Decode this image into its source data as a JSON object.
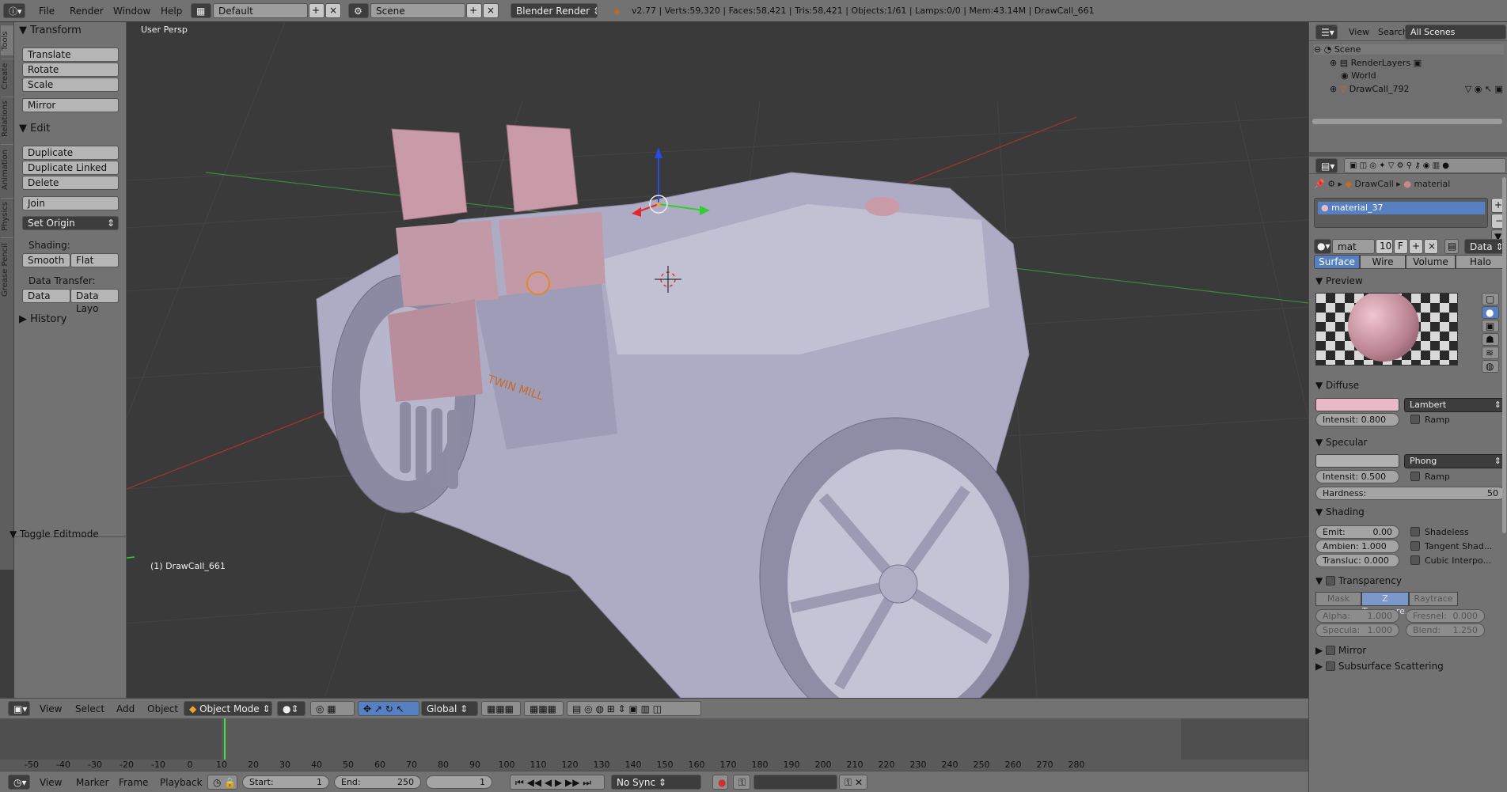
{
  "topbar": {
    "menus": [
      "File",
      "Render",
      "Window",
      "Help"
    ],
    "layout": "Default",
    "scene": "Scene",
    "engine": "Blender Render",
    "stats": "v2.77 | Verts:59,320 | Faces:58,421 | Tris:58,421 | Objects:1/61 | Lamps:0/0 | Mem:43.14M | DrawCall_661"
  },
  "left_tabs": [
    "Tools",
    "Create",
    "Relations",
    "Animation",
    "Physics",
    "Grease Pencil"
  ],
  "toolshelf": {
    "transform_header": "Transform",
    "translate": "Translate",
    "rotate": "Rotate",
    "scale": "Scale",
    "mirror": "Mirror",
    "edit_header": "Edit",
    "duplicate": "Duplicate",
    "duplicate_linked": "Duplicate Linked",
    "delete": "Delete",
    "join": "Join",
    "set_origin": "Set Origin",
    "shading_label": "Shading:",
    "smooth": "Smooth",
    "flat": "Flat",
    "data_transfer_label": "Data Transfer:",
    "data": "Data",
    "data_layout": "Data Layo",
    "history_header": "History",
    "toggle_editmode": "Toggle Editmode"
  },
  "viewport": {
    "view_label": "User Persp",
    "object_label": "(1) DrawCall_661",
    "decal_text": "TWIN MILL",
    "colors": {
      "body": "#aeacc4",
      "pink": "#c99aa8",
      "bg": "#3a3a3a"
    }
  },
  "view_header": {
    "menus": [
      "View",
      "Select",
      "Add",
      "Object"
    ],
    "mode": "Object Mode",
    "orientation": "Global"
  },
  "timeline": {
    "ticks": [
      "-50",
      "-40",
      "-30",
      "-20",
      "-10",
      "0",
      "10",
      "20",
      "30",
      "40",
      "50",
      "60",
      "70",
      "80",
      "90",
      "100",
      "110",
      "120",
      "130",
      "140",
      "150",
      "160",
      "170",
      "180",
      "190",
      "200",
      "210",
      "220",
      "230",
      "240",
      "250",
      "260",
      "270",
      "280"
    ],
    "current_frame_value": 0
  },
  "timeline_header": {
    "menus": [
      "View",
      "Marker",
      "Frame",
      "Playback"
    ],
    "start": "Start:",
    "start_val": "1",
    "end": "End:",
    "end_val": "250",
    "frame_val": "1",
    "sync": "No Sync"
  },
  "outliner": {
    "menus": [
      "View",
      "Search"
    ],
    "filter": "All Scenes",
    "items": [
      "Scene",
      "RenderLayers",
      "World",
      "DrawCall_792"
    ]
  },
  "properties": {
    "breadcrumb_obj": "DrawCall",
    "breadcrumb_mat": "material",
    "material_slot": "material_37",
    "mat_name": "mat",
    "users": "10",
    "fake": "F",
    "link": "Data",
    "tabs": [
      "Surface",
      "Wire",
      "Volume",
      "Halo"
    ],
    "preview_header": "Preview",
    "diffuse_header": "Diffuse",
    "diffuse_color": "#e8b9c6",
    "diffuse_shader": "Lambert",
    "diffuse_intensity": "Intensit: 0.800",
    "ramp": "Ramp",
    "specular_header": "Specular",
    "specular_color": "#b0b0b0",
    "specular_shader": "Phong",
    "specular_intensity": "Intensit: 0.500",
    "hardness_label": "Hardness:",
    "hardness_val": "50",
    "shading_header": "Shading",
    "emit": "Emit:",
    "emit_val": "0.00",
    "ambient": "Ambien: 1.000",
    "transluc": "Transluc: 0.000",
    "shadeless": "Shadeless",
    "tangent": "Tangent Shad...",
    "cubic": "Cubic Interpo...",
    "transparency_header": "Transparency",
    "trans_tabs": [
      "Mask",
      "Z Transpare...",
      "Raytrace"
    ],
    "alpha": "Alpha:",
    "alpha_val": "1.000",
    "fresnel": "Fresnel:",
    "fresnel_val": "0.000",
    "specula": "Specula:",
    "specula_val": "1.000",
    "blend": "Blend:",
    "blend_val": "1.250",
    "mirror_header": "Mirror",
    "sss_header": "Subsurface Scattering"
  }
}
